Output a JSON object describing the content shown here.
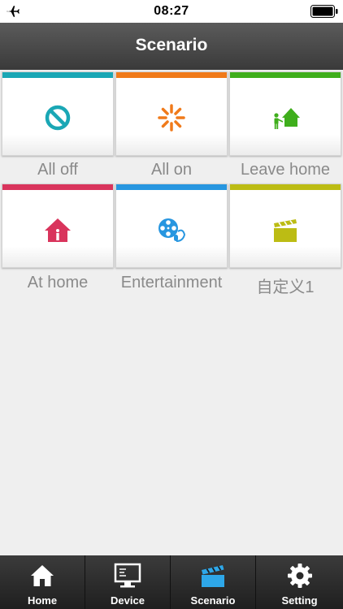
{
  "status_bar": {
    "time": "08:27"
  },
  "header": {
    "title": "Scenario"
  },
  "scenarios": [
    {
      "label": "All off",
      "color": "#1aa7b5",
      "icon": "block-icon"
    },
    {
      "label": "All on",
      "color": "#f07a1a",
      "icon": "sparkle-icon"
    },
    {
      "label": "Leave home",
      "color": "#3fae1c",
      "icon": "leave-home-icon"
    },
    {
      "label": "At home",
      "color": "#d9345c",
      "icon": "home-icon"
    },
    {
      "label": "Entertainment",
      "color": "#2796e0",
      "icon": "film-reel-icon"
    },
    {
      "label": "自定义1",
      "color": "#bcbc14",
      "icon": "clapperboard-icon"
    }
  ],
  "tabs": [
    {
      "label": "Home",
      "icon": "home-icon",
      "active": false
    },
    {
      "label": "Device",
      "icon": "monitor-icon",
      "active": false
    },
    {
      "label": "Scenario",
      "icon": "clapperboard-icon",
      "active": true
    },
    {
      "label": "Setting",
      "icon": "gear-icon",
      "active": false
    }
  ],
  "colors": {
    "tab_active": "#2ea7e8",
    "tab_inactive": "#ffffff"
  }
}
